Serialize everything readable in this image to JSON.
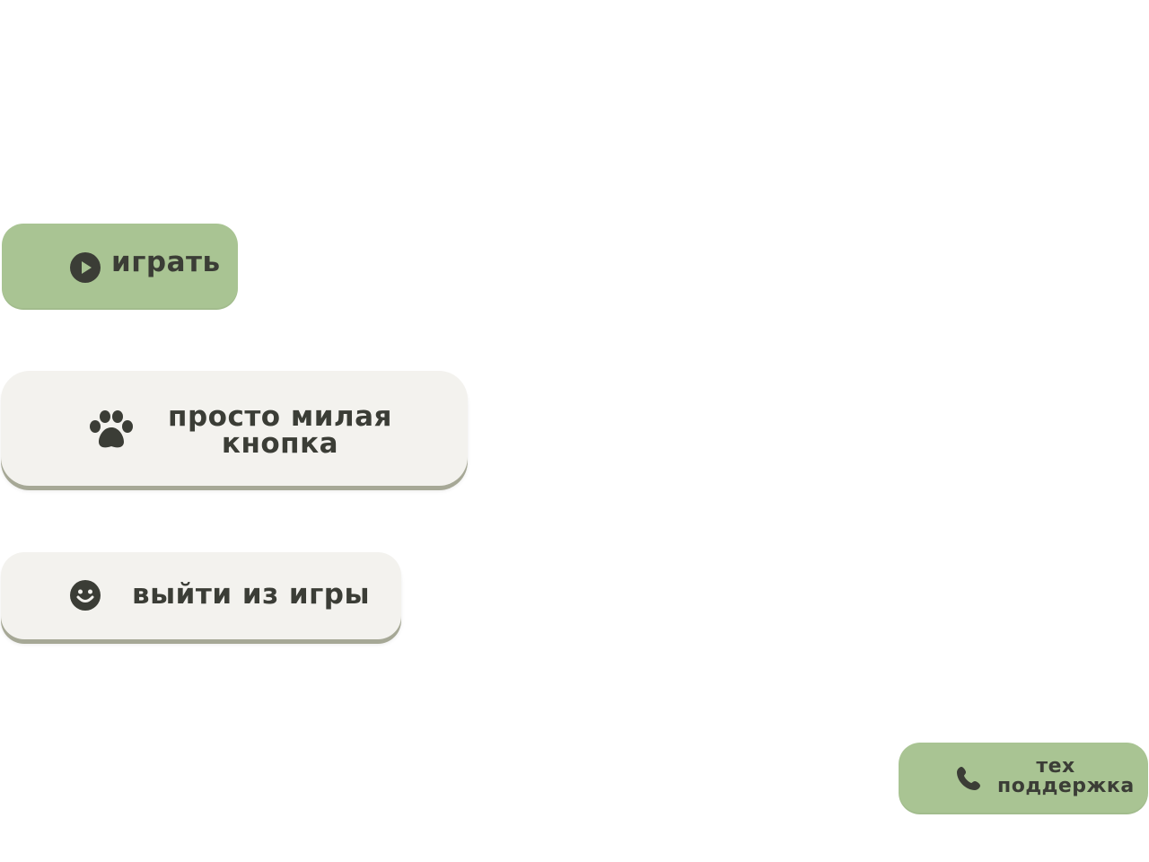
{
  "menu": {
    "play_label": "играть",
    "cute_label_line1": "просто милая",
    "cute_label_line2": "кнопка",
    "exit_label": "выйти из игры",
    "support_label_line1": "тех",
    "support_label_line2": "поддержка"
  },
  "icons": {
    "play": "play-icon",
    "paw": "paw-icon",
    "smile": "smile-icon",
    "phone": "phone-icon"
  },
  "colors": {
    "green_button": "#a9c493",
    "light_button": "#f3f2ee",
    "button_shadow": "#a6a896",
    "text": "#3b3d36"
  }
}
